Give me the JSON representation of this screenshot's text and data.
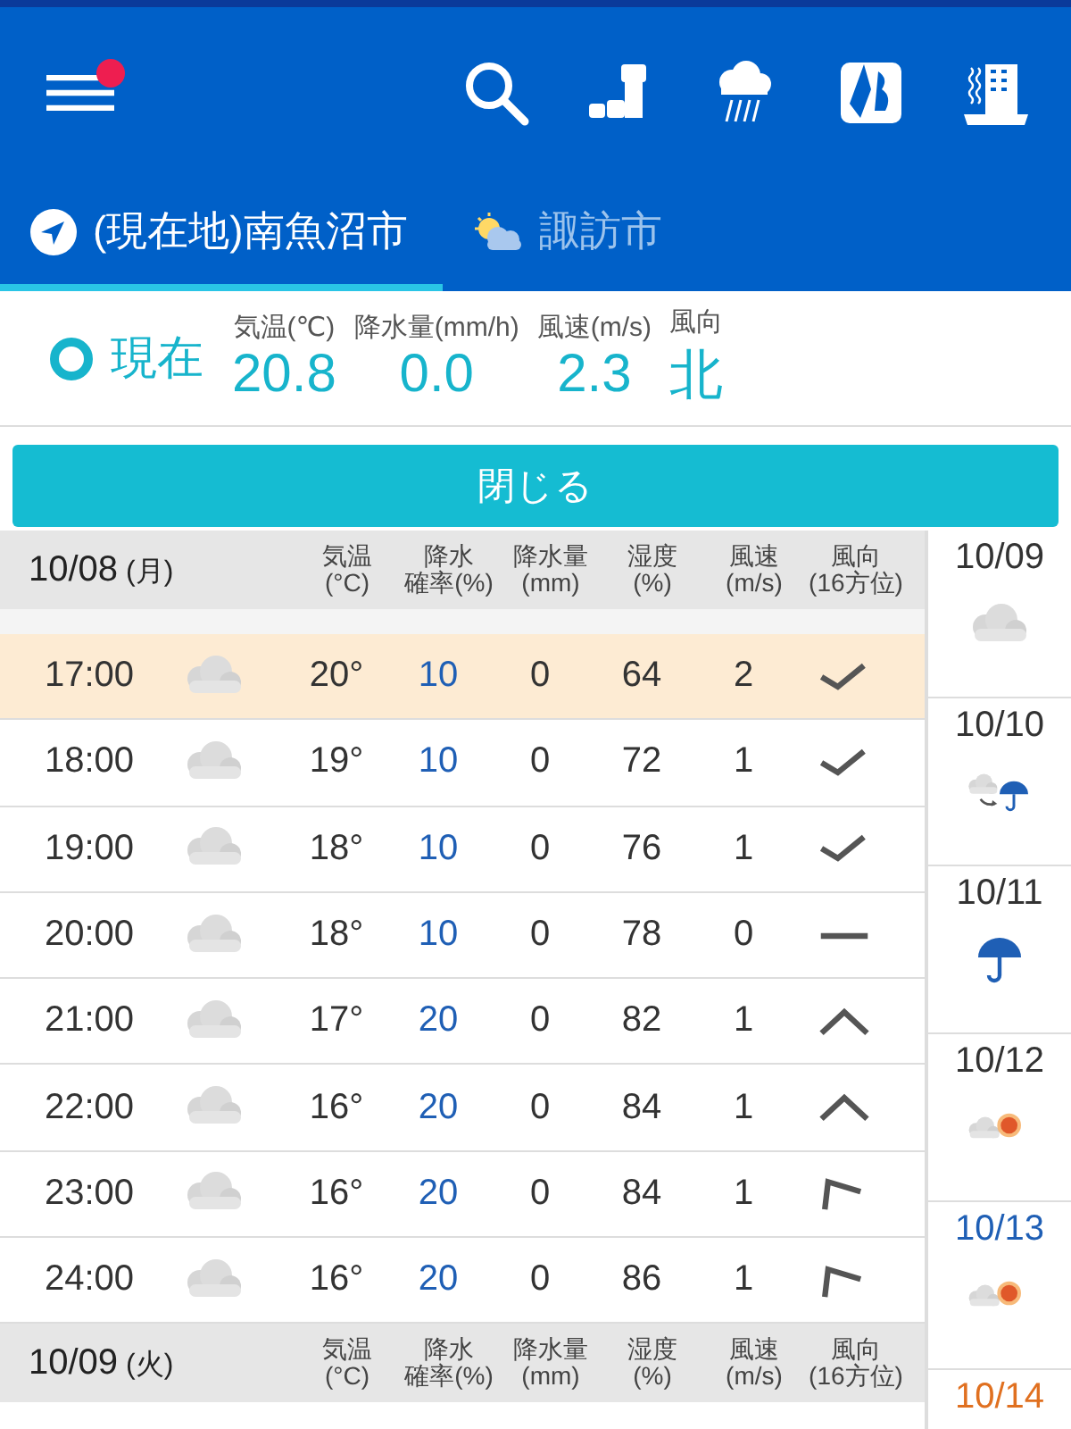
{
  "toolbar": {
    "menu_badge": true
  },
  "tabs": [
    {
      "label": "(現在地)南魚沼市",
      "kind": "location",
      "selected": true
    },
    {
      "label": "諏訪市",
      "kind": "weather",
      "selected": false
    }
  ],
  "current": {
    "label": "現在",
    "fields": [
      {
        "label": "気温(℃)",
        "value": "20.8"
      },
      {
        "label": "降水量(mm/h)",
        "value": "0.0"
      },
      {
        "label": "風速(m/s)",
        "value": "2.3"
      },
      {
        "label": "風向",
        "value": "北"
      }
    ]
  },
  "close_button": "閉じる",
  "days": [
    {
      "date": "10/08",
      "weekday": "(月)",
      "columns": [
        {
          "top": "気温",
          "bottom": "(°C)"
        },
        {
          "top": "降水",
          "bottom": "確率(%)"
        },
        {
          "top": "降水量",
          "bottom": "(mm)"
        },
        {
          "top": "湿度",
          "bottom": "(%)"
        },
        {
          "top": "風速",
          "bottom": "(m/s)"
        },
        {
          "top": "風向",
          "bottom": "(16方位)"
        }
      ],
      "rows": [
        {
          "time": "17:00",
          "temp": "20°",
          "pop": "10",
          "rain": "0",
          "humidity": "64",
          "wind_speed": "2",
          "kind": "check",
          "current": true
        },
        {
          "time": "18:00",
          "temp": "19°",
          "pop": "10",
          "rain": "0",
          "humidity": "72",
          "wind_speed": "1",
          "kind": "check",
          "current": false
        },
        {
          "time": "19:00",
          "temp": "18°",
          "pop": "10",
          "rain": "0",
          "humidity": "76",
          "wind_speed": "1",
          "kind": "check",
          "current": false
        },
        {
          "time": "20:00",
          "temp": "18°",
          "pop": "10",
          "rain": "0",
          "humidity": "78",
          "wind_speed": "0",
          "kind": "dash",
          "current": false
        },
        {
          "time": "21:00",
          "temp": "17°",
          "pop": "20",
          "rain": "0",
          "humidity": "82",
          "wind_speed": "1",
          "kind": "caret",
          "current": false
        },
        {
          "time": "22:00",
          "temp": "16°",
          "pop": "20",
          "rain": "0",
          "humidity": "84",
          "wind_speed": "1",
          "kind": "caret",
          "current": false
        },
        {
          "time": "23:00",
          "temp": "16°",
          "pop": "20",
          "rain": "0",
          "humidity": "84",
          "wind_speed": "1",
          "kind": "corner",
          "current": false
        },
        {
          "time": "24:00",
          "temp": "16°",
          "pop": "20",
          "rain": "0",
          "humidity": "86",
          "wind_speed": "1",
          "kind": "corner",
          "current": false
        }
      ]
    },
    {
      "date": "10/09",
      "weekday": "(火)",
      "columns": [
        {
          "top": "気温",
          "bottom": "(°C)"
        },
        {
          "top": "降水",
          "bottom": "確率(%)"
        },
        {
          "top": "降水量",
          "bottom": "(mm)"
        },
        {
          "top": "湿度",
          "bottom": "(%)"
        },
        {
          "top": "風速",
          "bottom": "(m/s)"
        },
        {
          "top": "風向",
          "bottom": "(16方位)"
        }
      ]
    }
  ],
  "week": [
    {
      "date": "10/09",
      "color": "#333333",
      "kind": "cloud"
    },
    {
      "date": "10/10",
      "color": "#333333",
      "kind": "cloud-to-rain"
    },
    {
      "date": "10/11",
      "color": "#333333",
      "kind": "rain"
    },
    {
      "date": "10/12",
      "color": "#333333",
      "kind": "cloud-sun"
    },
    {
      "date": "10/13",
      "color": "#1f5fb5",
      "kind": "cloud-sun"
    },
    {
      "date": "10/14",
      "color": "#e07020"
    }
  ]
}
